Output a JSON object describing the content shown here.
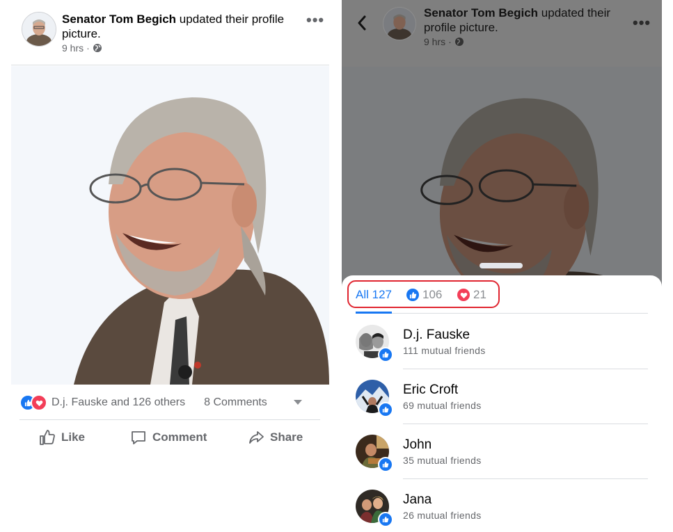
{
  "post": {
    "author": "Senator Tom Begich",
    "action_text": "updated their profile picture.",
    "action_line1": "updated their profile",
    "action_line2": "picture.",
    "action_line1_right": "updated their",
    "action_line2_right": "profile picture.",
    "time": "9 hrs",
    "separator": "·",
    "more_icon": "•••",
    "privacy_icon": "globe-icon"
  },
  "engagement": {
    "reactors_summary": "D.j. Fauske and 126 others",
    "comments": "8 Comments"
  },
  "actions": {
    "like": "Like",
    "comment": "Comment",
    "share": "Share"
  },
  "reactions_sheet": {
    "tabs": [
      {
        "label": "All 127",
        "icon": ""
      },
      {
        "label": "106",
        "icon": "like-icon"
      },
      {
        "label": "21",
        "icon": "love-icon"
      }
    ],
    "people": [
      {
        "name": "D.j. Fauske",
        "mutual": "111 mutual friends",
        "reaction": "like"
      },
      {
        "name": "Eric Croft",
        "mutual": "69 mutual friends",
        "reaction": "like"
      },
      {
        "name": "John",
        "mutual": "35 mutual friends",
        "reaction": "like"
      },
      {
        "name": "Jana",
        "mutual": "26 mutual friends",
        "reaction": "like"
      }
    ]
  },
  "colors": {
    "accent": "#1877f2",
    "love": "#f33e58",
    "highlight_box": "#e0242f",
    "muted_text": "#65676b"
  }
}
